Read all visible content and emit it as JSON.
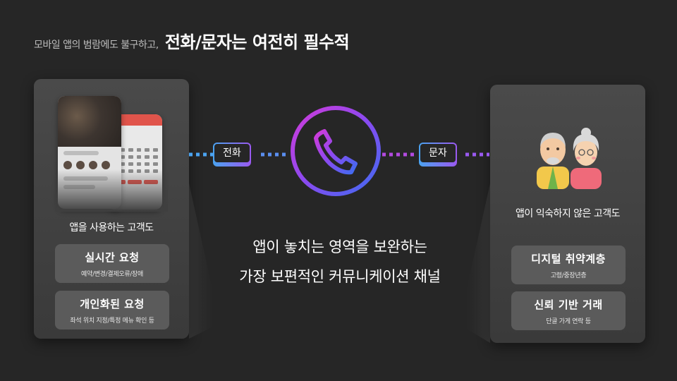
{
  "headline": {
    "sub": "모바일 앱의 범람에도 불구하고,",
    "main": "전화/문자는 여전히 필수적"
  },
  "left_panel": {
    "title": "앱을 사용하는 고객도",
    "cards": [
      {
        "title": "실시간 요청",
        "desc": "예약/변경/결제오류/장애"
      },
      {
        "title": "개인화된 요청",
        "desc": "좌석 위치 지정/특정 메뉴 확인 등"
      }
    ]
  },
  "right_panel": {
    "title": "앱이 익숙하지 않은 고객도",
    "cards": [
      {
        "title": "디지털 취약계층",
        "desc": "고령/중장년층"
      },
      {
        "title": "신뢰 기반 거래",
        "desc": "단골 가게 연락 등"
      }
    ]
  },
  "channels": {
    "left": "전화",
    "right": "문자"
  },
  "center": {
    "line1": "앱이 놓치는 영역을 보완하는",
    "line2": "가장 보편적인 커뮤니케이션 채널"
  },
  "colors": {
    "blue": "#4aa3f0",
    "purple": "#9a59f0",
    "magenta": "#d23bd9",
    "background": "#262626"
  },
  "icons": [
    "phone-icon",
    "elderly-couple-icon",
    "app-mockup"
  ]
}
